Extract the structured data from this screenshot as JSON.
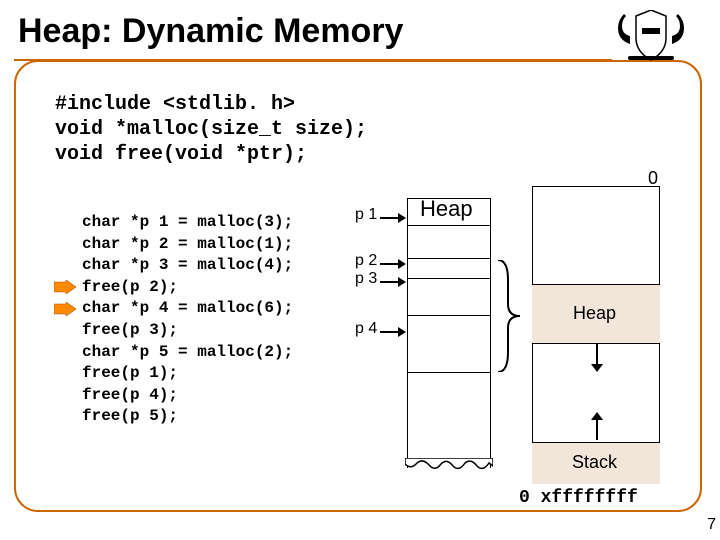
{
  "title": "Heap: Dynamic Memory",
  "code_top": "#include <stdlib. h>\nvoid *malloc(size_t size);\nvoid free(void *ptr);",
  "code_left": "char *p 1 = malloc(3);\nchar *p 2 = malloc(1);\nchar *p 3 = malloc(4);\nfree(p 2);\nchar *p 4 = malloc(6);\nfree(p 3);\nchar *p 5 = malloc(2);\nfree(p 1);\nfree(p 4);\nfree(p 5);",
  "heap_title": "Heap",
  "pointers": {
    "p1": "p 1",
    "p2": "p 2",
    "p3": "p 3",
    "p4": "p 4"
  },
  "mem": {
    "zero": "0",
    "heap": "Heap",
    "stack": "Stack",
    "addr": "0 xffffffff"
  },
  "page": "7"
}
